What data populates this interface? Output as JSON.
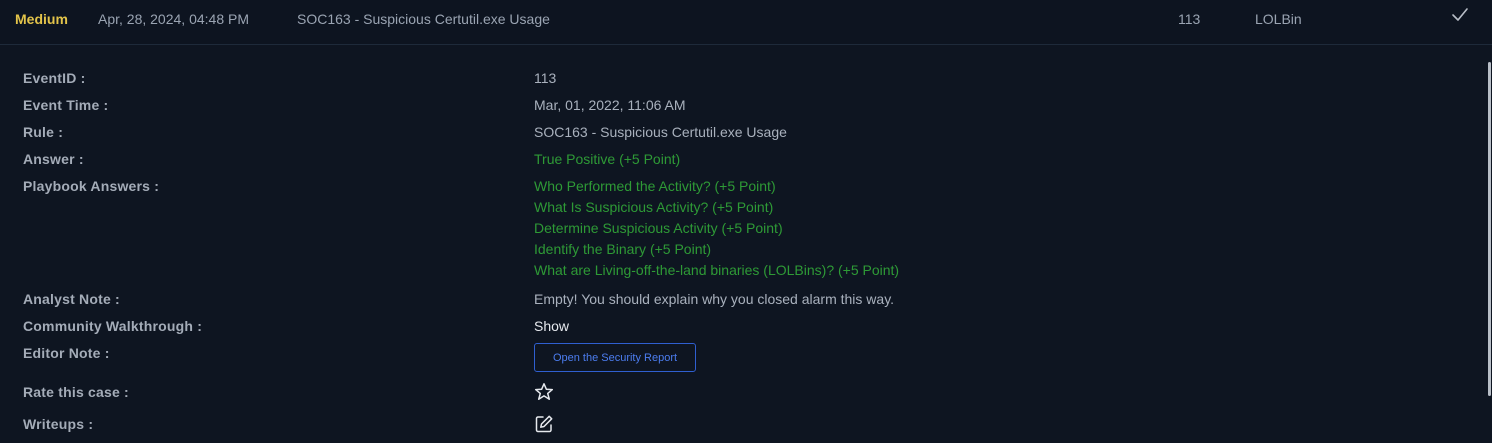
{
  "alert": {
    "severity": "Medium",
    "date": "Apr, 28, 2024, 04:48 PM",
    "rule": "SOC163 - Suspicious Certutil.exe Usage",
    "event_id": "113",
    "category": "LOLBin",
    "closed_icon": "check-icon"
  },
  "labels": {
    "event_id": "EventID :",
    "event_time": "Event Time :",
    "rule": "Rule :",
    "answer": "Answer :",
    "playbook": "Playbook Answers :",
    "analyst_note": "Analyst Note :",
    "walkthrough": "Community Walkthrough :",
    "editor_note": "Editor Note :",
    "rate": "Rate this case :",
    "writeups": "Writeups :"
  },
  "details": {
    "event_id": "113",
    "event_time": "Mar, 01, 2022, 11:06 AM",
    "rule": "SOC163 - Suspicious Certutil.exe Usage",
    "answer": "True Positive (+5 Point)",
    "playbook_answers": [
      "Who Performed the Activity? (+5 Point)",
      "What Is Suspicious Activity? (+5 Point)",
      "Determine Suspicious Activity (+5 Point)",
      "Identify the Binary (+5 Point)",
      "What are Living-off-the-land binaries (LOLBins)? (+5 Point)"
    ],
    "analyst_note": "Empty! You should explain why you closed alarm this way.",
    "walkthrough_link": "Show",
    "report_button": "Open the Security Report",
    "rate_icon": "star-icon",
    "writeups_icon": "edit-icon"
  },
  "colors": {
    "background": "#0e1521",
    "severity": "#e3c44a",
    "correct": "#2e9a36",
    "button": "#2f5fd0"
  }
}
